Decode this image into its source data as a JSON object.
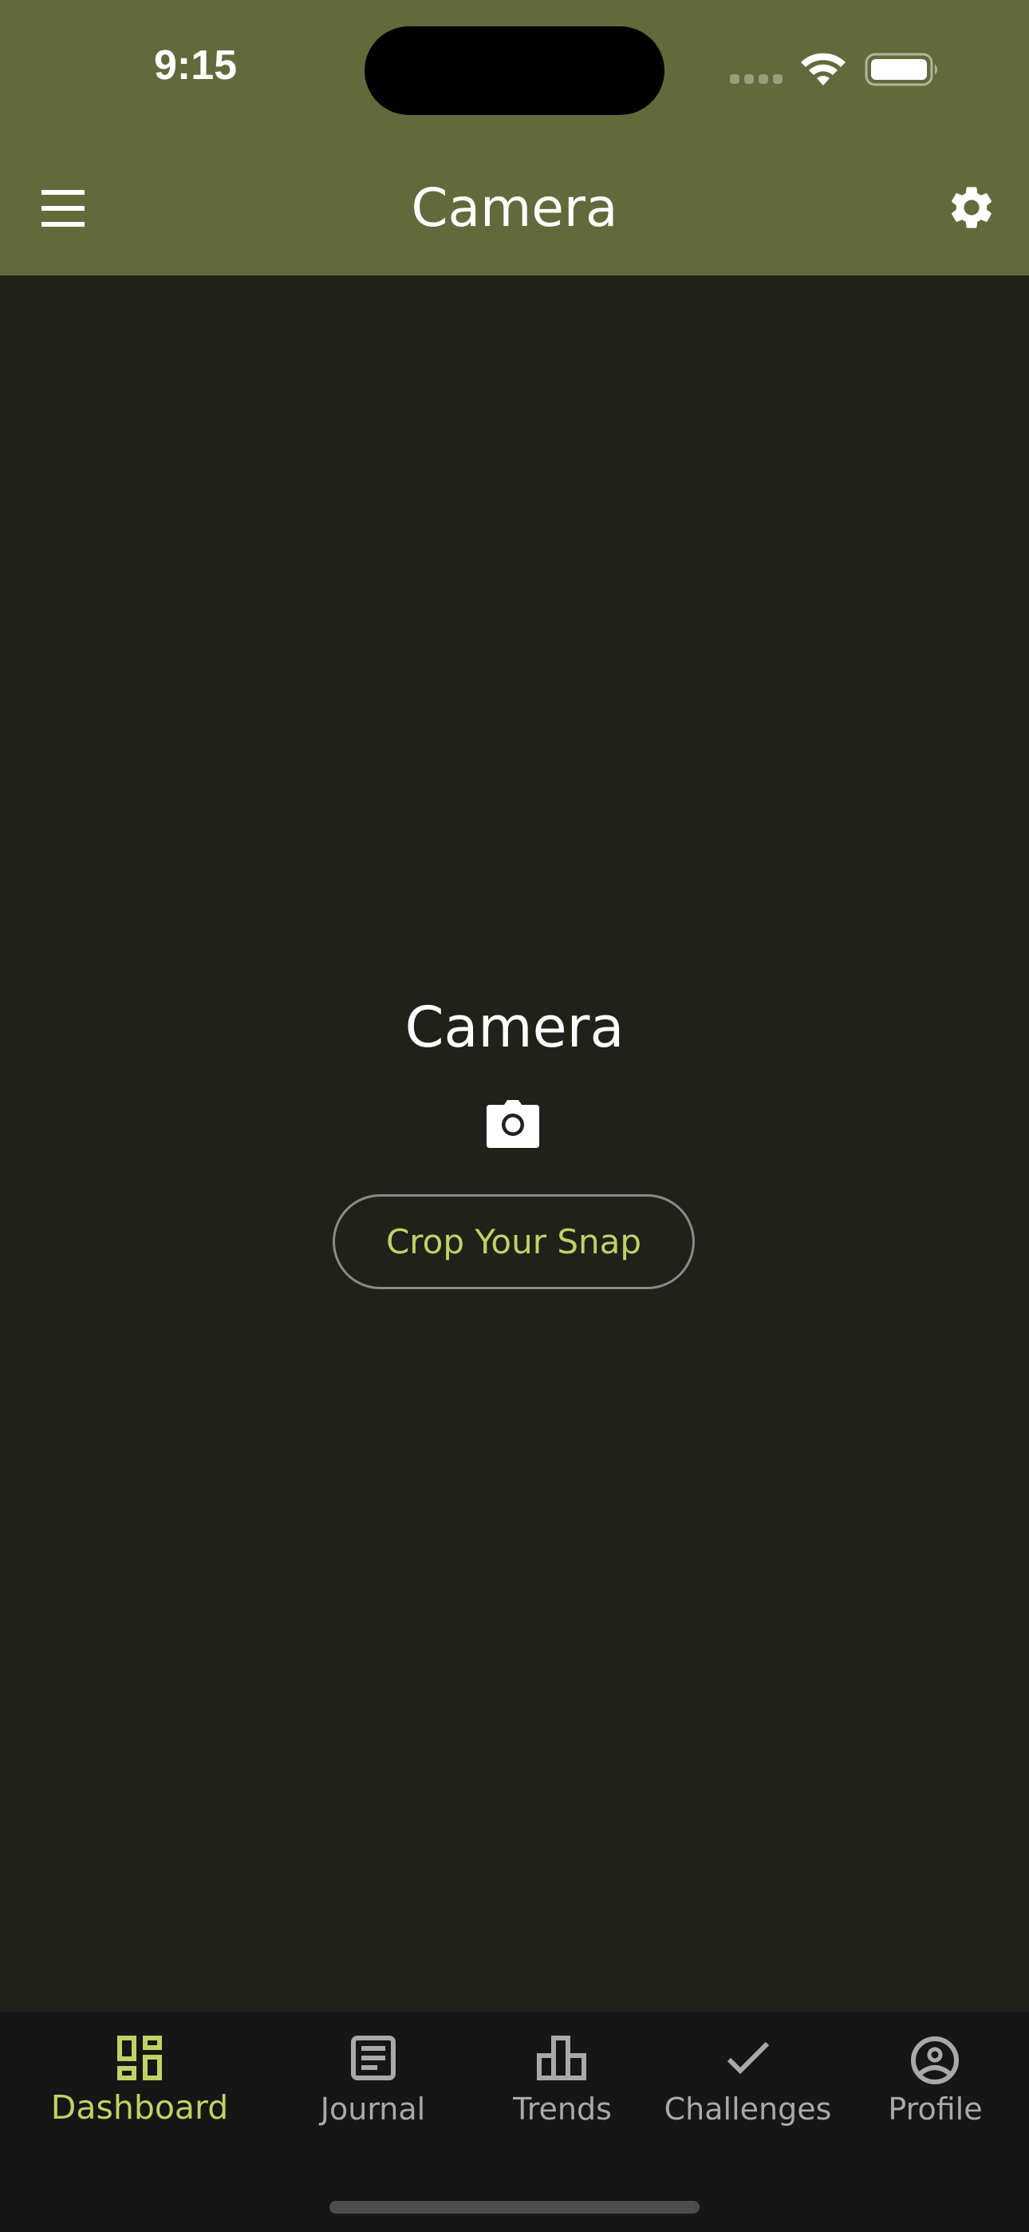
{
  "status_bar": {
    "time": "9:15",
    "icons": [
      "signal-icon",
      "wifi-icon",
      "battery-icon"
    ]
  },
  "app_bar": {
    "title": "Camera",
    "menu_icon": "hamburger-menu-icon",
    "settings_icon": "gear-icon"
  },
  "main": {
    "title": "Camera",
    "icon": "camera-icon",
    "crop_button_label": "Crop Your Snap"
  },
  "bottom_nav": {
    "items": [
      {
        "label": "Dashboard",
        "icon": "dashboard-icon",
        "active": true
      },
      {
        "label": "Journal",
        "icon": "journal-icon",
        "active": false
      },
      {
        "label": "Trends",
        "icon": "bar-chart-icon",
        "active": false
      },
      {
        "label": "Challenges",
        "icon": "checkmark-icon",
        "active": false
      },
      {
        "label": "Profile",
        "icon": "account-circle-icon",
        "active": false
      }
    ]
  },
  "colors": {
    "header_bg": "#626a3b",
    "content_bg": "#20211a",
    "nav_bg": "#161616",
    "accent": "#c2d166",
    "inactive": "#a9a9a9"
  }
}
